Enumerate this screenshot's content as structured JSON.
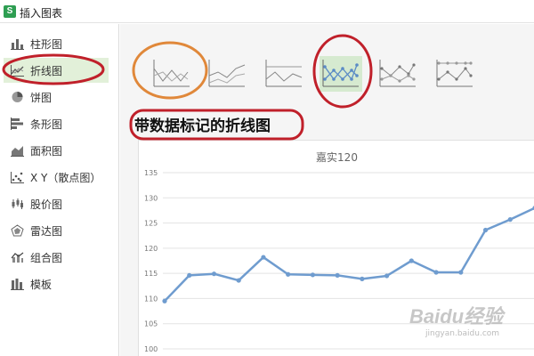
{
  "window": {
    "title": "插入图表",
    "app_icon_glyph": "S"
  },
  "sidebar": {
    "items": [
      {
        "label": "柱形图",
        "icon": "column-chart-icon"
      },
      {
        "label": "折线图",
        "icon": "line-chart-icon",
        "selected": true
      },
      {
        "label": "饼图",
        "icon": "pie-chart-icon"
      },
      {
        "label": "条形图",
        "icon": "bar-chart-icon"
      },
      {
        "label": "面积图",
        "icon": "area-chart-icon"
      },
      {
        "label": "X Y（散点图）",
        "icon": "scatter-chart-icon"
      },
      {
        "label": "股价图",
        "icon": "stock-chart-icon"
      },
      {
        "label": "雷达图",
        "icon": "radar-chart-icon"
      },
      {
        "label": "组合图",
        "icon": "combo-chart-icon"
      },
      {
        "label": "模板",
        "icon": "template-icon"
      }
    ]
  },
  "subtypes": {
    "selected_index": 3,
    "items": [
      {
        "icon": "line-chart-variant-icon"
      },
      {
        "icon": "stacked-line-chart-icon"
      },
      {
        "icon": "percent-stacked-line-chart-icon"
      },
      {
        "icon": "line-with-markers-chart-icon"
      },
      {
        "icon": "stacked-line-with-markers-chart-icon"
      },
      {
        "icon": "percent-stacked-line-with-markers-chart-icon"
      }
    ]
  },
  "section": {
    "title": "带数据标记的折线图"
  },
  "colors": {
    "accent_green": "#d6ead0",
    "sidebar_selected": "#e2f0d9",
    "series_line": "#6f9ccf",
    "annotation_red": "#c0202a",
    "annotation_orange": "#e0883a"
  },
  "chart_data": {
    "type": "line",
    "title": "嘉实120",
    "ylim": [
      100,
      135
    ],
    "yticks": [
      100,
      105,
      110,
      115,
      120,
      125,
      130,
      135
    ],
    "grid": true,
    "series": [
      {
        "values": [
          109.5,
          114.6,
          114.9,
          113.6,
          118.2,
          114.8,
          114.7,
          114.6,
          113.9,
          114.5,
          117.5,
          115.2,
          115.2,
          123.6,
          125.7,
          128.0
        ]
      }
    ]
  },
  "watermark": {
    "text": "Baidu经验",
    "subtext": "jingyan.baidu.com"
  }
}
